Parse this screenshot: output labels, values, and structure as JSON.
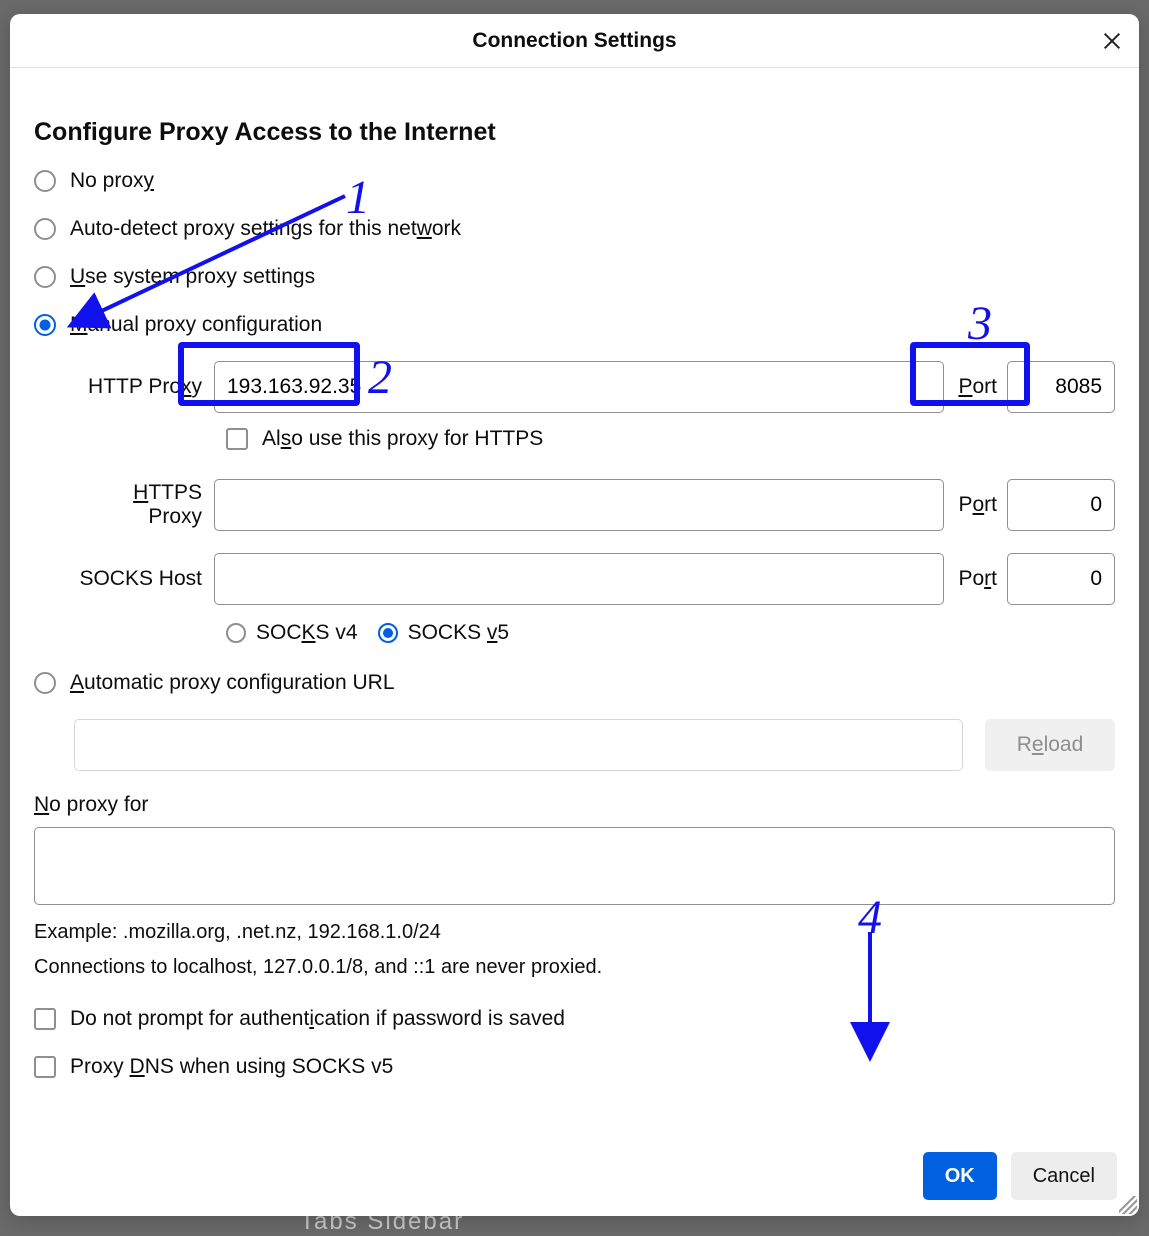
{
  "dialog": {
    "title": "Connection Settings",
    "section_heading": "Configure Proxy Access to the Internet"
  },
  "radios": {
    "no_proxy": "No proxy",
    "auto_detect": "Auto-detect proxy settings for this network",
    "system": "Use system proxy settings",
    "manual": "Manual proxy configuration",
    "auto_url": "Automatic proxy configuration URL",
    "selected": "manual"
  },
  "proxy": {
    "http_label": "HTTP Proxy",
    "http_host": "193.163.92.35",
    "http_port": "8085",
    "also_https": "Also use this proxy for HTTPS",
    "https_label": "HTTPS Proxy",
    "https_host": "",
    "https_port": "0",
    "socks_label": "SOCKS Host",
    "socks_host": "",
    "socks_port": "0",
    "port_label": "Port",
    "socks_v4": "SOCKS v4",
    "socks_v5": "SOCKS v5",
    "socks_selected": "v5"
  },
  "pac": {
    "url": "",
    "reload": "Reload"
  },
  "no_proxy_for": {
    "label": "No proxy for",
    "value": "",
    "example": "Example: .mozilla.org, .net.nz, 192.168.1.0/24",
    "note": "Connections to localhost, 127.0.0.1/8, and ::1 are never proxied."
  },
  "checks": {
    "no_auth_prompt": "Do not prompt for authentication if password is saved",
    "proxy_dns": "Proxy DNS when using SOCKS v5"
  },
  "buttons": {
    "ok": "OK",
    "cancel": "Cancel"
  },
  "annotations": {
    "n1": "1",
    "n2": "2",
    "n3": "3",
    "n4": "4"
  }
}
